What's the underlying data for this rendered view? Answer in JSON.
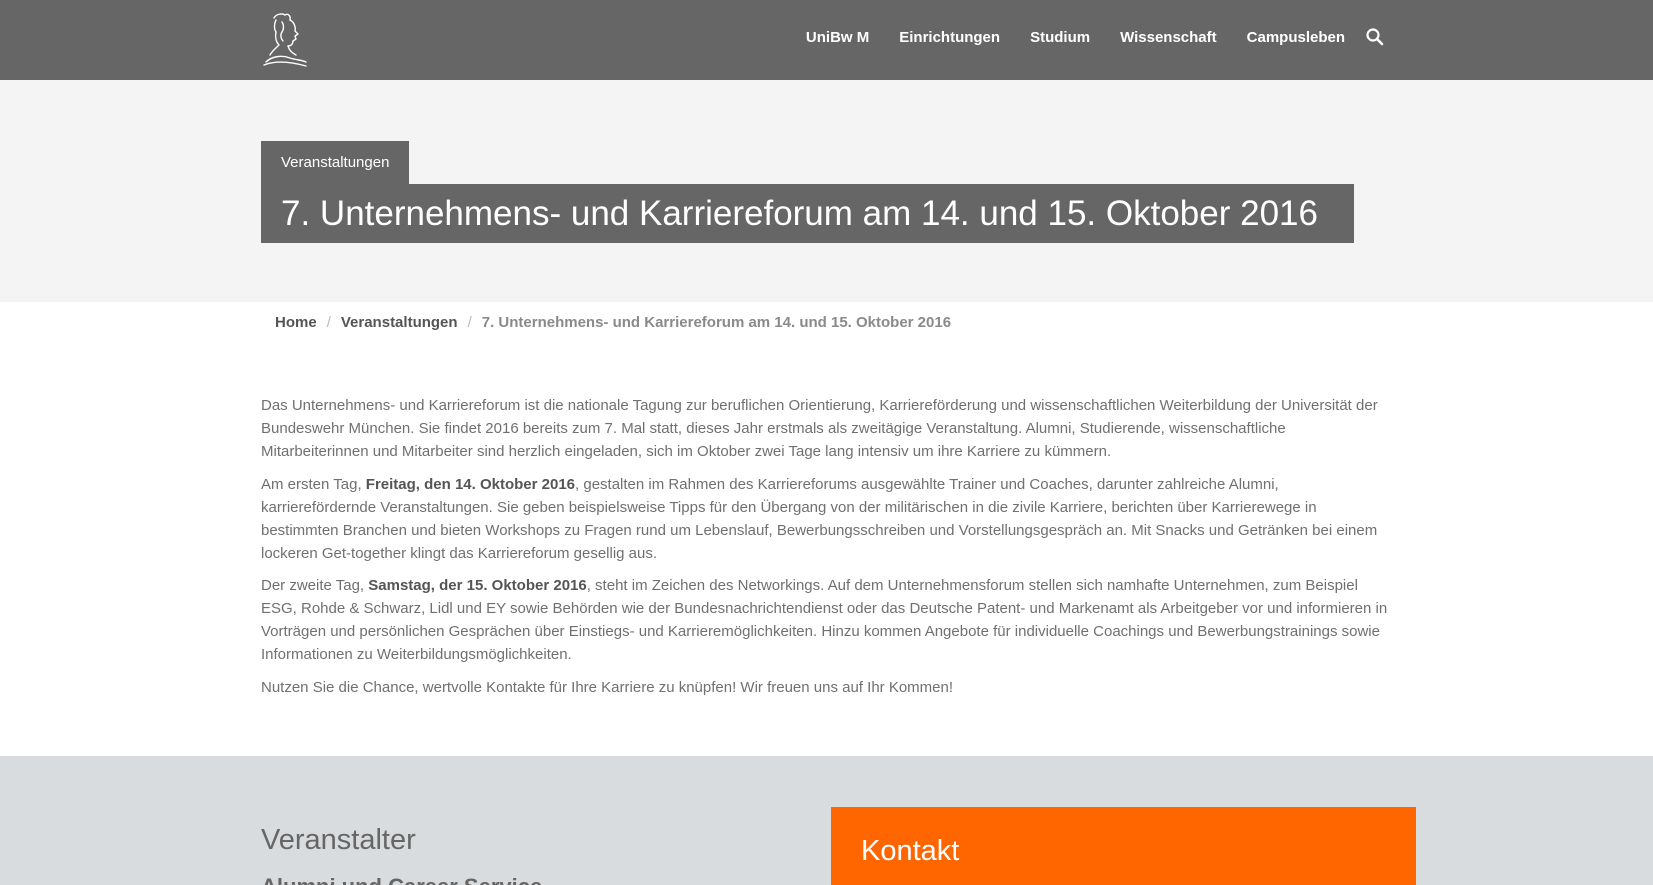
{
  "header": {
    "logo": "minerva-head-logo",
    "nav": [
      "UniBw M",
      "Einrichtungen",
      "Studium",
      "Wissenschaft",
      "Campusleben"
    ],
    "search_icon": "search-icon"
  },
  "hero": {
    "category": "Veranstaltungen",
    "title": "7. Unternehmens- und Karriereforum am 14. und 15. Oktober 2016"
  },
  "breadcrumb": {
    "home": "Home",
    "separator": "/",
    "section": "Veranstaltungen",
    "current": "7. Unternehmens- und Karriereforum am 14. und 15. Oktober 2016"
  },
  "content": {
    "p1": "Das Unternehmens- und Karriereforum ist die nationale Tagung zur beruflichen Orientierung, Karriereförderung und wissenschaftlichen Weiterbildung der Universität der Bundeswehr München. Sie findet 2016 bereits zum 7. Mal statt, dieses Jahr erstmals als zweitägige Veranstaltung. Alumni, Studierende, wissenschaftliche Mitarbeiterinnen und Mitarbeiter sind herzlich eingeladen, sich im Oktober zwei Tage lang intensiv um ihre Karriere zu kümmern.",
    "p2_before": "Am ersten Tag, ",
    "p2_bold": "Freitag, den 14. Oktober 2016",
    "p2_after": ", gestalten im Rahmen des Karriereforums ausgewählte Trainer und Coaches, darunter zahlreiche Alumni, karrierefördernde Veranstaltungen. Sie geben beispielsweise Tipps für den Übergang von der militärischen in die zivile Karriere, berichten über Karrierewege in bestimmten Branchen und bieten Workshops zu Fragen rund um Lebenslauf, Bewerbungsschreiben und Vorstellungsgespräch an. Mit Snacks und Getränken bei einem lockeren Get-together klingt das Karriereforum gesellig aus.",
    "p3_before": "Der zweite Tag, ",
    "p3_bold": "Samstag, der 15. Oktober 2016",
    "p3_after": ", steht im Zeichen des Networkings. Auf dem Unternehmensforum stellen sich namhafte Unternehmen, zum Beispiel ESG, Rohde & Schwarz, Lidl und EY sowie Behörden wie der Bundesnachrichtendienst oder das Deutsche Patent- und Markenamt als Arbeitgeber vor und informieren in Vorträgen und persönlichen Gesprächen über Einstiegs- und Karrieremöglichkeiten. Hinzu kommen Angebote für individuelle Coachings und Bewerbungstrainings sowie Informationen zu Weiterbildungsmöglichkeiten.",
    "p4": "Nutzen Sie die Chance, wertvolle Kontakte für Ihre Karriere zu knüpfen! Wir freuen uns auf Ihr Kommen!"
  },
  "footer": {
    "organizer_heading": "Veranstalter",
    "organizer_name": "Alumni und Career Service",
    "contact_heading": "Kontakt"
  },
  "colors": {
    "header_bg": "#666666",
    "hero_bg": "#f4f4f4",
    "footer_bg": "#d9dcde",
    "accent": "#ff6600"
  }
}
